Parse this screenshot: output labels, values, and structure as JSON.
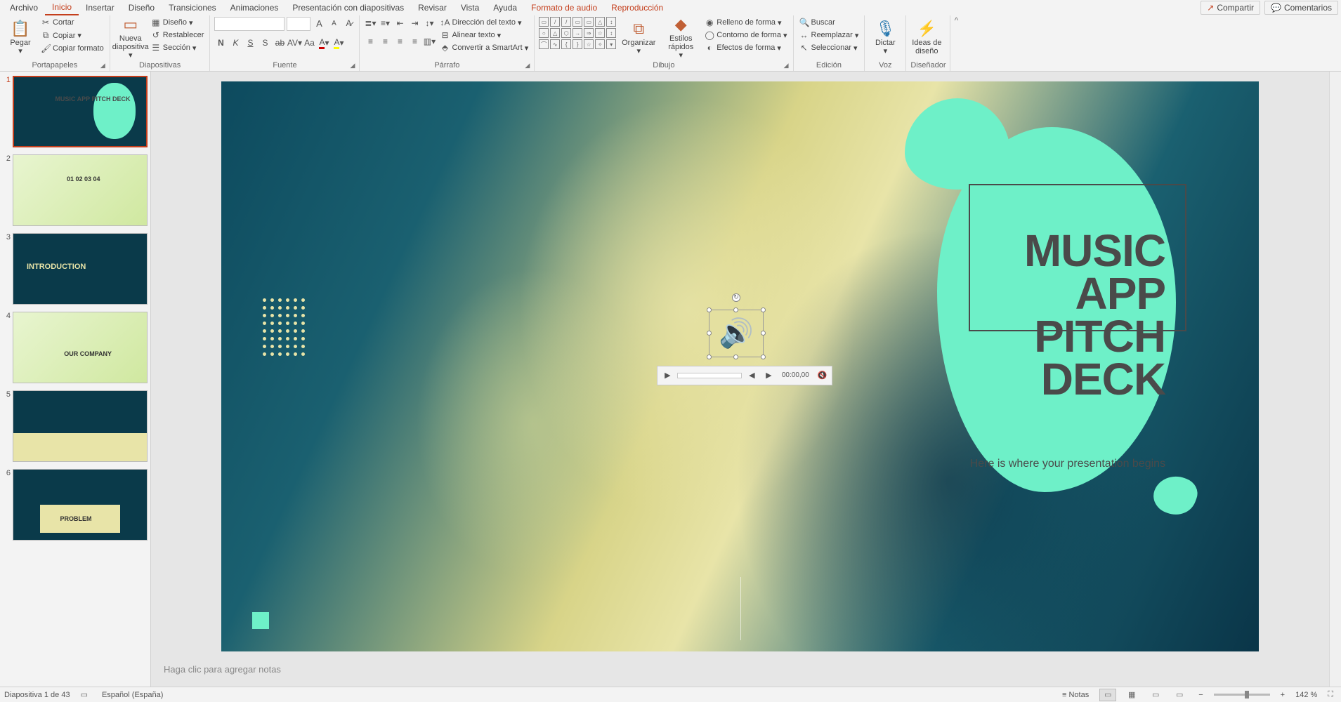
{
  "tabs": {
    "file": "Archivo",
    "items": [
      "Inicio",
      "Insertar",
      "Diseño",
      "Transiciones",
      "Animaciones",
      "Presentación con diapositivas",
      "Revisar",
      "Vista",
      "Ayuda"
    ],
    "context": [
      "Formato de audio",
      "Reproducción"
    ],
    "active": "Inicio",
    "share": "Compartir",
    "comments": "Comentarios"
  },
  "ribbon": {
    "clipboard": {
      "label": "Portapapeles",
      "paste": "Pegar",
      "cut": "Cortar",
      "copy": "Copiar",
      "format_painter": "Copiar formato"
    },
    "slides": {
      "label": "Diapositivas",
      "new_slide": "Nueva diapositiva",
      "layout": "Diseño",
      "reset": "Restablecer",
      "section": "Sección"
    },
    "font": {
      "label": "Fuente",
      "name": "",
      "size": "",
      "increase": "A",
      "decrease": "A",
      "clear": "A",
      "bold": "N",
      "italic": "K",
      "underline": "S",
      "strike": "S",
      "shadow": "S",
      "spacing": "AV",
      "case": "Aa"
    },
    "paragraph": {
      "label": "Párrafo",
      "text_direction": "Dirección del texto",
      "align_text": "Alinear texto",
      "smartart": "Convertir a SmartArt"
    },
    "drawing": {
      "label": "Dibujo",
      "arrange": "Organizar",
      "quick_styles": "Estilos rápidos",
      "shape_fill": "Relleno de forma",
      "shape_outline": "Contorno de forma",
      "shape_effects": "Efectos de forma"
    },
    "editing": {
      "label": "Edición",
      "find": "Buscar",
      "replace": "Reemplazar",
      "select": "Seleccionar"
    },
    "voice": {
      "label": "Voz",
      "dictate": "Dictar"
    },
    "designer": {
      "label": "Diseñador",
      "ideas": "Ideas de diseño"
    }
  },
  "thumbnails": [
    {
      "n": 1,
      "title": "MUSIC APP PITCH DECK",
      "kind": "cover"
    },
    {
      "n": 2,
      "title": "01 02 03 04",
      "kind": "agenda"
    },
    {
      "n": 3,
      "title": "INTRODUCTION",
      "kind": "section"
    },
    {
      "n": 4,
      "title": "OUR COMPANY",
      "kind": "content"
    },
    {
      "n": 5,
      "title": "",
      "kind": "team"
    },
    {
      "n": 6,
      "title": "PROBLEM",
      "kind": "content"
    }
  ],
  "slide": {
    "title_line1": "MUSIC",
    "title_line2": "APP PITCH",
    "title_line3": "DECK",
    "subtitle": "Here is where your presentation begins"
  },
  "audio_player": {
    "time": "00:00,00"
  },
  "notes_placeholder": "Haga clic para agregar notas",
  "status": {
    "slide_pos": "Diapositiva 1 de 43",
    "lang": "Español (España)",
    "notes": "Notas",
    "zoom": "142 %"
  },
  "colors": {
    "accent": "#c43e1c",
    "mint": "#6ef0c8",
    "slide_dark": "#0a3a4a"
  }
}
